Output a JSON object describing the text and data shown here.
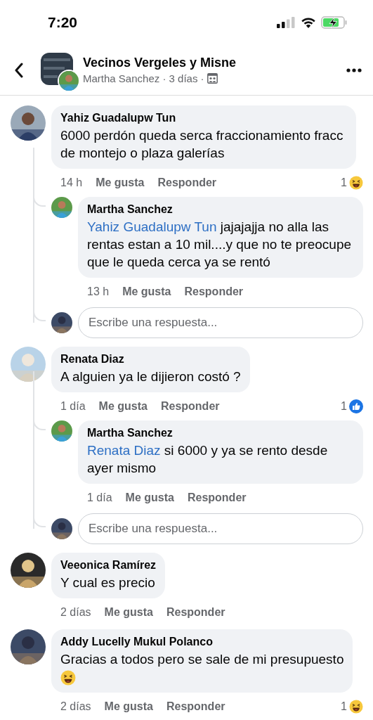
{
  "status_bar": {
    "time": "7:20"
  },
  "header": {
    "title": "Vecinos Vergeles y Misne",
    "subtitle": "Martha Sanchez · 3 días ·"
  },
  "comments": [
    {
      "author": "Yahiz Guadalupw Tun",
      "text": "6000 perdón queda serca fraccionamiento fracc de montejo o plaza galerías",
      "time": "14 h",
      "like_label": "Me gusta",
      "reply_label": "Responder",
      "reactions": {
        "count": "1",
        "kind": "haha"
      },
      "replies": [
        {
          "author": "Martha Sanchez",
          "mention": "Yahiz Guadalupw Tun",
          "text": "jajajajja no alla las rentas estan a 10 mil....y que no te preocupe que le queda cerca ya se rentó",
          "time": "13 h",
          "like_label": "Me gusta",
          "reply_label": "Responder"
        }
      ],
      "reply_box": {
        "placeholder": "Escribe una respuesta..."
      }
    },
    {
      "author": "Renata Diaz",
      "text": "A alguien ya le dijieron costó ?",
      "time": "1 día",
      "like_label": "Me gusta",
      "reply_label": "Responder",
      "reactions": {
        "count": "1",
        "kind": "like"
      },
      "replies": [
        {
          "author": "Martha Sanchez",
          "mention": "Renata Diaz",
          "text": "si 6000 y ya se rento desde ayer mismo",
          "time": "1 día",
          "like_label": "Me gusta",
          "reply_label": "Responder"
        }
      ],
      "reply_box": {
        "placeholder": "Escribe una respuesta..."
      }
    },
    {
      "author": "Veeonica Ramírez",
      "text": "Y cual es precio",
      "time": "2 días",
      "like_label": "Me gusta",
      "reply_label": "Responder"
    },
    {
      "author": "Addy Lucelly Mukul Polanco",
      "text": "Gracias a todos pero se sale de mi presupuesto",
      "trailing_emoji": {
        "kind": "haha"
      },
      "time": "2 días",
      "like_label": "Me gusta",
      "reply_label": "Responder",
      "reactions": {
        "count": "1",
        "kind": "haha"
      }
    }
  ]
}
